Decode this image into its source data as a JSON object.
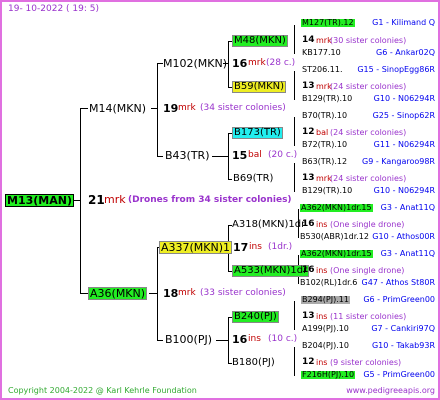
{
  "header": {
    "date": "19-  10-2022  (  19:   5)"
  },
  "footer": {
    "copyright": "Copyright 2004-2022 @ Karl Kehrle Foundation",
    "site": "www.pedigreeapis.org"
  },
  "colors": {
    "frame": "#e070e0",
    "green": "#22ee22",
    "yellow": "#eeee22",
    "cyan": "#22eeee",
    "gray": "#aaaaaa",
    "blue": "#0000ee",
    "red": "#c00000",
    "purple": "#9933cc"
  },
  "root": {
    "name": "M13(MAN)",
    "num": "21",
    "mrk": "mrk",
    "note": "(Drones from 34 sister colonies)"
  },
  "gen1": {
    "top": {
      "name": "M14(MKN)",
      "num": "19",
      "mrk": "mrk",
      "note": "(34 sister colonies)"
    },
    "bot": {
      "name": "A36(MKN)",
      "num": "18",
      "mrk": "mrk",
      "note": "(33 sister colonies)"
    }
  },
  "gen2": {
    "a": {
      "name": "M102(MKN)",
      "num": "16",
      "mrk": "mrk",
      "note": "(28 c.)"
    },
    "b": {
      "name": "B43(TR)",
      "num": "15",
      "mrk": "bal",
      "note": "(20 c.)"
    },
    "c": {
      "name": "A337(MKN)1",
      "num": "17",
      "mrk": "ins",
      "note": "(1dr.)"
    },
    "d": {
      "name": "B100(PJ)",
      "num": "16",
      "mrk": "ins",
      "note": "(10 c.)"
    }
  },
  "gen3": [
    {
      "name": "M48(MKN)",
      "num": "14",
      "mrk": "mrk",
      "note": "(30 sister colonies)"
    },
    {
      "name": "B59(MKN)",
      "num": "13",
      "mrk": "mrk",
      "note": "(24 sister colonies)"
    },
    {
      "name": "B173(TR)",
      "num": "12",
      "mrk": "bal",
      "note": "(24 sister colonies)"
    },
    {
      "name": "B69(TR)",
      "num": "13",
      "mrk": "mrk",
      "note": "(24 sister colonies)"
    },
    {
      "name": "A318(MKN)1dr",
      "num": "16",
      "mrk": "ins",
      "note": "(One single drone)"
    },
    {
      "name": "A533(MKN)1dr",
      "num": "16",
      "mrk": "ins",
      "note": "(One single drone)"
    },
    {
      "name": "B240(PJ)",
      "num": "13",
      "mrk": "ins",
      "note": "(11 sister colonies)"
    },
    {
      "name": "B180(PJ)",
      "num": "12",
      "mrk": "ins",
      "note": "(9 sister colonies)"
    }
  ],
  "gen4": [
    {
      "name": "M127(TR).12",
      "code": "G1 - Kilimand Q"
    },
    {
      "name": "KB177.10",
      "code": "G6 - Ankar02Q"
    },
    {
      "name": "ST206.11.",
      "code": "G15 - SinopEgg86R"
    },
    {
      "name": "B129(TR).10",
      "code": "G10 - N06294R"
    },
    {
      "name": "B70(TR).10",
      "code": "G25 - Sinop62R"
    },
    {
      "name": "B72(TR).10",
      "code": "G11 - N06294R"
    },
    {
      "name": "B63(TR).12",
      "code": "G9 - Kangaroo98R"
    },
    {
      "name": "B129(TR).10",
      "code": "G10 - N06294R"
    },
    {
      "name": "A362(MKN)1dr.15",
      "code": "G3 - Anat11Q"
    },
    {
      "name": "B530(ABR)1dr.12",
      "code": "G10 - Athos00R"
    },
    {
      "name": "A362(MKN)1dr.15",
      "code": "G3 - Anat11Q"
    },
    {
      "name": "B102(RL)1dr.6",
      "code": "G47 - Athos St80R"
    },
    {
      "name": "B294(PJ).11",
      "code": "G6 - PrimGreen00"
    },
    {
      "name": "A199(PJ).10",
      "code": "G7 - Cankiri97Q"
    },
    {
      "name": "B204(PJ).10",
      "code": "G10 - Takab93R"
    },
    {
      "name": "F216H(PJ).10",
      "code": "G5 - PrimGreen00"
    }
  ]
}
